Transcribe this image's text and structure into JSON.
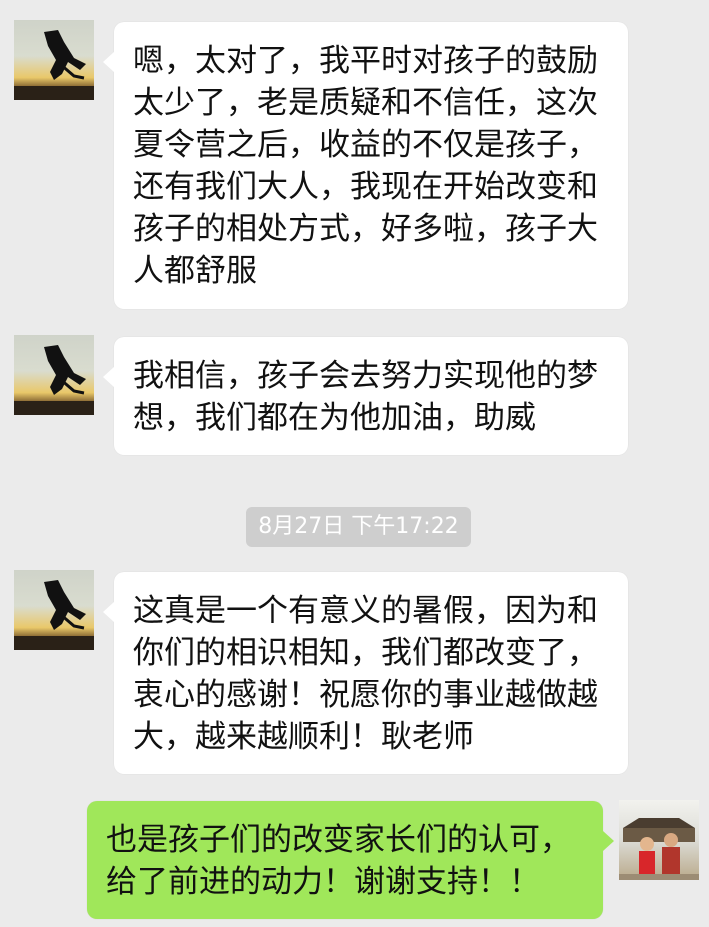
{
  "messages": [
    {
      "side": "left",
      "avatar_icon": "silhouette-sunset-avatar-icon",
      "lines": [
        "嗯，太对了，我平时对孩子的鼓励",
        "太少了，老是质疑和不信任，这次",
        "夏令营之后，收益的不仅是孩子，",
        "还有我们大人，我现在开始改变和",
        "孩子的相处方式，好多啦，孩子大",
        "人都舒服"
      ]
    },
    {
      "side": "left",
      "avatar_icon": "silhouette-sunset-avatar-icon",
      "lines": [
        "我相信，孩子会去努力实现他的梦",
        "想，我们都在为他加油，助威"
      ]
    },
    {
      "side": "left",
      "avatar_icon": "silhouette-sunset-avatar-icon",
      "lines": [
        "这真是一个有意义的暑假，因为和",
        "你们的相识相知，我们都改变了，",
        "衷心的感谢！祝愿你的事业越做越",
        "大，越来越顺利！耿老师"
      ]
    },
    {
      "side": "right",
      "avatar_icon": "couple-photo-avatar-icon",
      "lines": [
        "也是孩子们的改变家长们的认可，",
        "给了前进的动力！谢谢支持！！"
      ]
    }
  ],
  "timestamp": "8月27日 下午17:22",
  "colors": {
    "background": "#ebebeb",
    "incoming_bubble": "#ffffff",
    "outgoing_bubble": "#a0e75a",
    "timestamp_bg": "#cecece"
  }
}
